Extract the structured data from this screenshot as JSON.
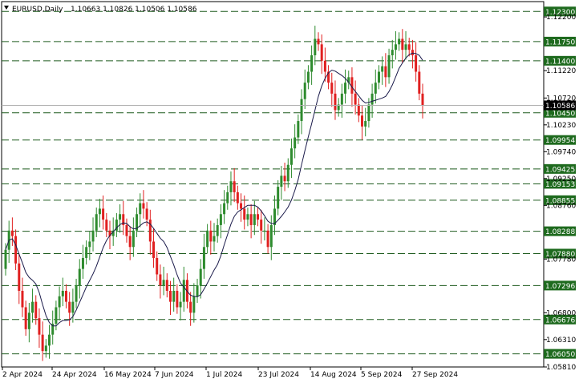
{
  "chart_data": {
    "type": "candlestick",
    "symbol_label": "EURUSD,Daily",
    "ohlc_label": "1.10663 1.10826 1.10506 1.10586",
    "ylim": [
      1.0581,
      1.1248
    ],
    "y_ticks": [
      "1.12200",
      "1.11220",
      "1.10720",
      "1.10230",
      "1.09740",
      "1.09250",
      "1.08760",
      "1.07780",
      "1.06800",
      "1.06310",
      "1.05810"
    ],
    "x_ticks": [
      "2 Apr 2024",
      "24 Apr 2024",
      "16 May 2024",
      "7 Jun 2024",
      "1 Jul 2024",
      "23 Jul 2024",
      "14 Aug 2024",
      "5 Sep 2024",
      "27 Sep 2024"
    ],
    "levels": [
      {
        "value": 1.123,
        "label": "1.12300"
      },
      {
        "value": 1.1175,
        "label": "1.11750"
      },
      {
        "value": 1.114,
        "label": "1.11400"
      },
      {
        "value": 1.1045,
        "label": "1.10450"
      },
      {
        "value": 1.09954,
        "label": "1.09954"
      },
      {
        "value": 1.09425,
        "label": "1.09425"
      },
      {
        "value": 1.09153,
        "label": "1.09153"
      },
      {
        "value": 1.08855,
        "label": "1.08855"
      },
      {
        "value": 1.08288,
        "label": "1.08288"
      },
      {
        "value": 1.0788,
        "label": "1.07880"
      },
      {
        "value": 1.07296,
        "label": "1.07296"
      },
      {
        "value": 1.06676,
        "label": "1.06676"
      },
      {
        "value": 1.0605,
        "label": "1.06050"
      }
    ],
    "current_price": {
      "value": 1.10586,
      "label": "1.10586"
    },
    "closes": [
      1.0795,
      1.083,
      1.082,
      1.077,
      1.072,
      1.069,
      1.065,
      1.068,
      1.07,
      1.067,
      1.064,
      1.061,
      1.062,
      1.064,
      1.066,
      1.069,
      1.071,
      1.072,
      1.07,
      1.068,
      1.07,
      1.073,
      1.076,
      1.078,
      1.08,
      1.081,
      1.083,
      1.086,
      1.087,
      1.085,
      1.083,
      1.082,
      1.083,
      1.085,
      1.086,
      1.084,
      1.082,
      1.08,
      1.083,
      1.086,
      1.088,
      1.087,
      1.085,
      1.081,
      1.078,
      1.075,
      1.073,
      1.074,
      1.072,
      1.07,
      1.072,
      1.069,
      1.07,
      1.074,
      1.07,
      1.068,
      1.071,
      1.073,
      1.076,
      1.08,
      1.083,
      1.081,
      1.082,
      1.084,
      1.086,
      1.088,
      1.09,
      1.092,
      1.09,
      1.088,
      1.087,
      1.085,
      1.086,
      1.084,
      1.086,
      1.085,
      1.083,
      1.083,
      1.08,
      1.084,
      1.087,
      1.091,
      1.093,
      1.092,
      1.095,
      1.098,
      1.1,
      1.103,
      1.107,
      1.11,
      1.112,
      1.115,
      1.118,
      1.117,
      1.114,
      1.112,
      1.11,
      1.108,
      1.105,
      1.106,
      1.108,
      1.11,
      1.111,
      1.108,
      1.106,
      1.104,
      1.102,
      1.103,
      1.106,
      1.108,
      1.11,
      1.112,
      1.113,
      1.111,
      1.115,
      1.116,
      1.117,
      1.118,
      1.116,
      1.117,
      1.116,
      1.115,
      1.112,
      1.108,
      1.10586
    ]
  }
}
